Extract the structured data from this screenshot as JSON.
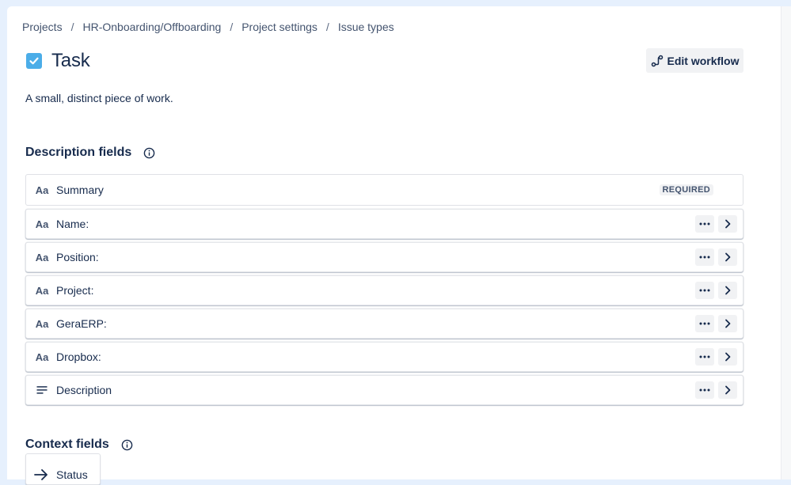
{
  "breadcrumbs": [
    "Projects",
    "HR-Onboarding/Offboarding",
    "Project settings",
    "Issue types"
  ],
  "separator": "/",
  "header": {
    "title": "Task",
    "icon": "checkbox-icon",
    "icon_color": "#4bade8",
    "edit_workflow_label": "Edit workflow"
  },
  "description": "A small, distinct piece of work.",
  "description_fields": {
    "heading": "Description fields",
    "required_label": "REQUIRED",
    "items": [
      {
        "icon": "Aa",
        "label": "Summary"
      },
      {
        "icon": "Aa",
        "label": "Name:"
      },
      {
        "icon": "Aa",
        "label": "Position:"
      },
      {
        "icon": "Aa",
        "label": "Project:"
      },
      {
        "icon": "Aa",
        "label": "GeraERP:"
      },
      {
        "icon": "Aa",
        "label": "Dropbox:"
      },
      {
        "icon": "paragraph-icon",
        "label": "Description"
      }
    ]
  },
  "context_fields": {
    "heading": "Context fields",
    "items": [
      {
        "icon": "arrow-right-icon",
        "label": "Status"
      }
    ]
  },
  "colors": {
    "page_bg": "#e6f0fd",
    "text": "#172b4d",
    "subtle_text": "#44546f",
    "button_bg": "#f1f2f4"
  }
}
